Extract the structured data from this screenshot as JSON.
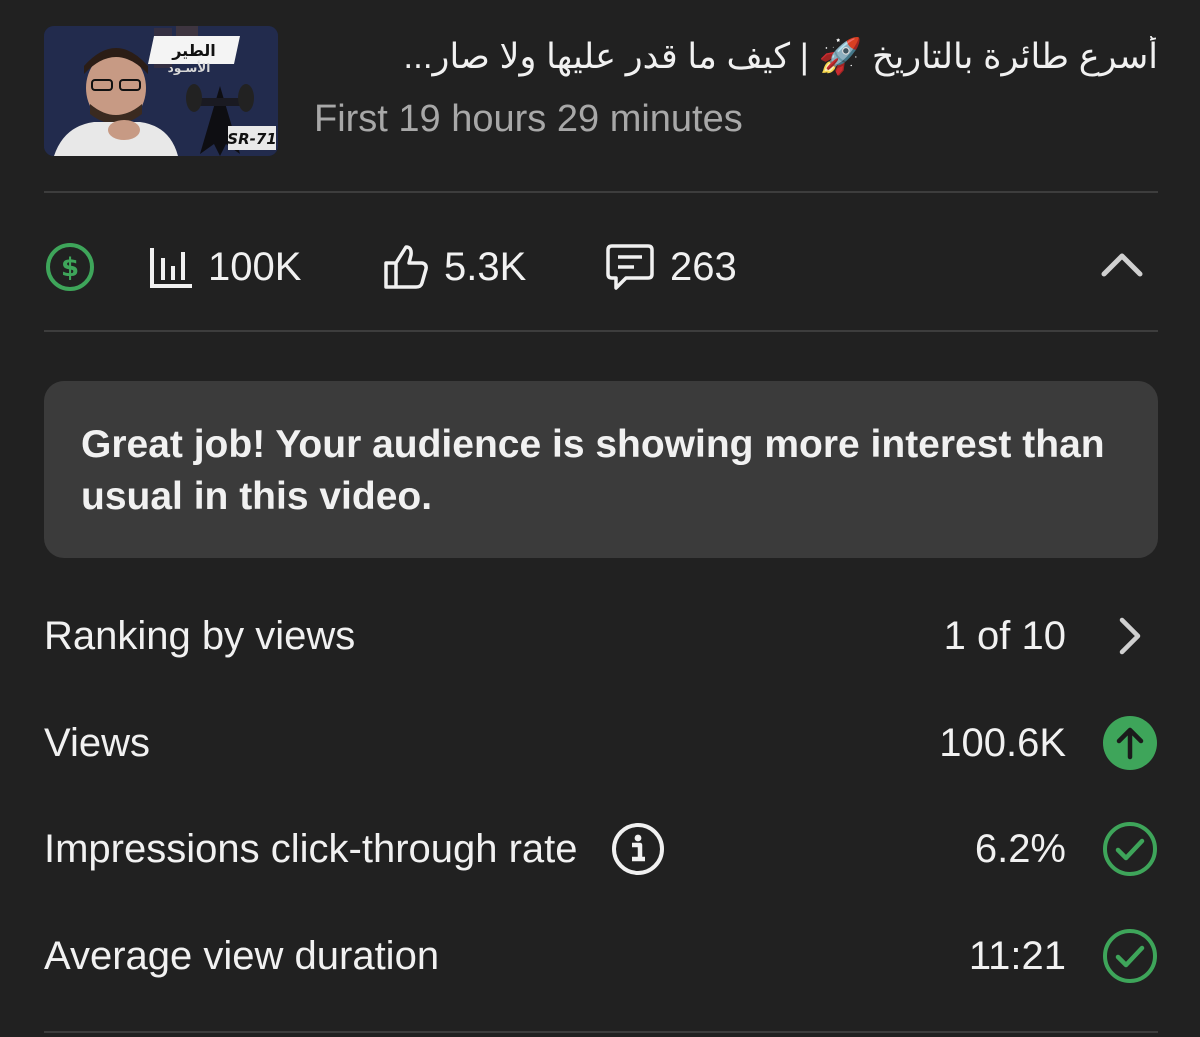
{
  "video": {
    "title": "أسرع طائرة بالتاريخ 🚀 | كيف ما قدر عليها ولا صار...",
    "subtitle": "First 19 hours 29 minutes",
    "thumbnail": {
      "overlay_text_1": "الطير",
      "overlay_text_2": "الأسـود",
      "badge_text": "SR-71"
    }
  },
  "stats": {
    "monetization_icon": "dollar-circle-icon",
    "views": "100K",
    "likes": "5.3K",
    "comments": "263",
    "collapse_icon": "chevron-up-icon"
  },
  "banner": {
    "message": "Great job! Your audience is showing more interest than usual in this video."
  },
  "metrics": {
    "ranking": {
      "label": "Ranking by views",
      "value": "1 of 10",
      "icon": "chevron-right-icon"
    },
    "views": {
      "label": "Views",
      "value": "100.6K",
      "icon": "arrow-up-circle-icon"
    },
    "ctr": {
      "label": "Impressions click-through rate",
      "value": "6.2%",
      "icon": "check-circle-icon",
      "info_icon": "info-icon"
    },
    "avg_duration": {
      "label": "Average view duration",
      "value": "11:21",
      "icon": "check-circle-icon"
    }
  },
  "colors": {
    "background": "#212121",
    "banner": "#3b3b3b",
    "divider": "#3d3d3d",
    "accent_green": "#3ea55a",
    "muted_text": "#a8a8a8",
    "text": "#f1f1f1"
  }
}
